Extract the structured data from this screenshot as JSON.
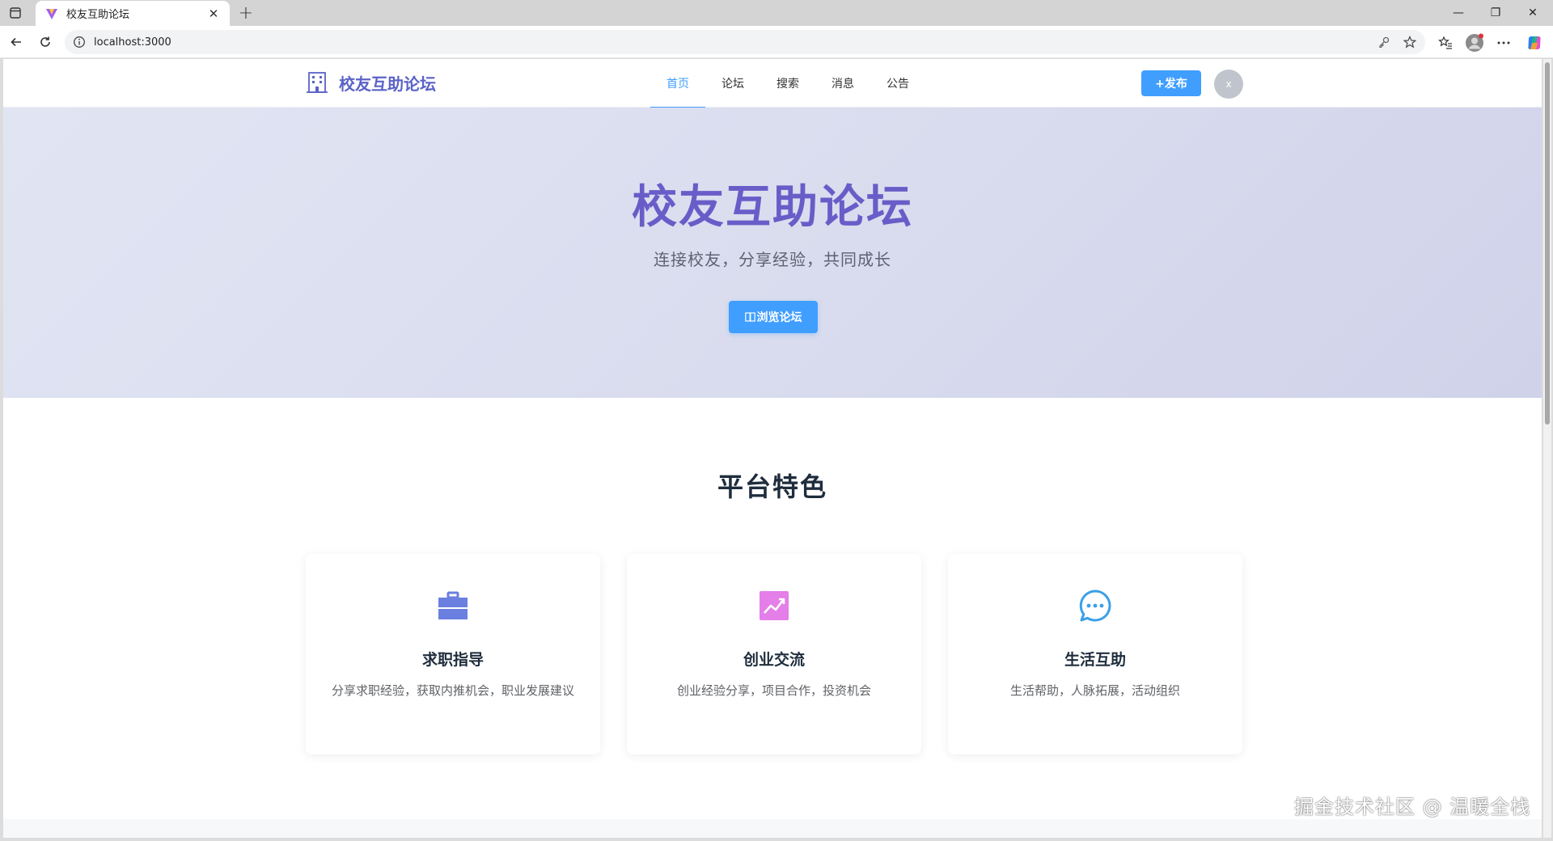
{
  "browser": {
    "tab_title": "校友互助论坛",
    "url": "localhost:3000",
    "new_tab_symbol": "+",
    "close_symbol": "✕",
    "minimize_symbol": "—",
    "restore_symbol": "❐",
    "window_close_symbol": "✕"
  },
  "header": {
    "logo_text": "校友互助论坛",
    "nav": [
      {
        "label": "首页",
        "active": true
      },
      {
        "label": "论坛",
        "active": false
      },
      {
        "label": "搜索",
        "active": false
      },
      {
        "label": "消息",
        "active": false
      },
      {
        "label": "公告",
        "active": false
      }
    ],
    "publish_label": "+发布",
    "avatar_text": "x"
  },
  "hero": {
    "title": "校友互助论坛",
    "subtitle": "连接校友，分享经验，共同成长",
    "browse_label": "浏览论坛"
  },
  "features": {
    "title": "平台特色",
    "items": [
      {
        "name": "求职指导",
        "desc": "分享求职经验，获取内推机会，职业发展建议",
        "icon": "briefcase-icon",
        "color": "#6b7fe0"
      },
      {
        "name": "创业交流",
        "desc": "创业经验分享，项目合作，投资机会",
        "icon": "trend-chart-icon",
        "color": "#e47ee8"
      },
      {
        "name": "生活互助",
        "desc": "生活帮助，人脉拓展，活动组织",
        "icon": "chat-bubble-icon",
        "color": "#3aa0e8"
      }
    ]
  },
  "colors": {
    "primary": "#409eff",
    "logo": "#5b63c7",
    "hero_title": "#6a5cc8"
  },
  "watermark": "掘金技术社区 @ 温暖全栈"
}
